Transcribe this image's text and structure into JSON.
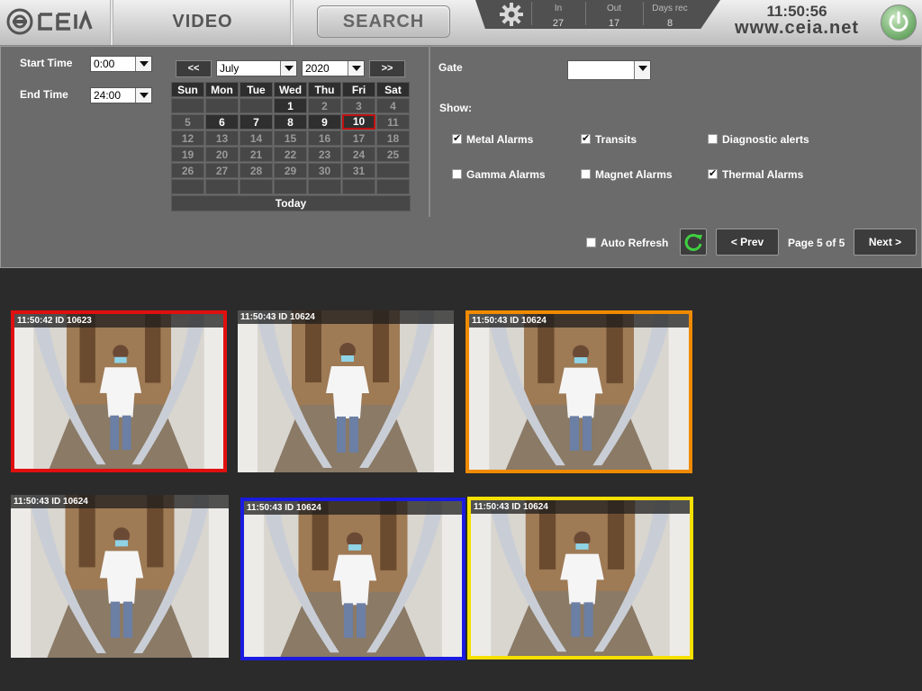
{
  "header": {
    "nav": {
      "video": "VIDEO",
      "search": "SEARCH"
    },
    "stats": [
      {
        "label": "In",
        "value": "27"
      },
      {
        "label": "Out",
        "value": "17"
      },
      {
        "label": "Days rec",
        "value": "8"
      }
    ],
    "clock": "11:50:56",
    "website": "www.ceia.net",
    "icons": {
      "logo": "ceia-logo",
      "settings": "gear-icon",
      "power": "power-icon"
    }
  },
  "filters": {
    "start_time_label": "Start Time",
    "start_time_value": "0:00",
    "end_time_label": "End Time",
    "end_time_value": "24:00",
    "prev_month": "<<",
    "next_month": ">>",
    "month": "July",
    "year": "2020",
    "gate_label": "Gate",
    "gate_value": "",
    "show_label": "Show:"
  },
  "calendar": {
    "weekdays": [
      "Sun",
      "Mon",
      "Tue",
      "Wed",
      "Thu",
      "Fri",
      "Sat"
    ],
    "weeks": [
      [
        "",
        "",
        "",
        "1",
        "2",
        "3",
        "4"
      ],
      [
        "5",
        "6",
        "7",
        "8",
        "9",
        "10",
        "11"
      ],
      [
        "12",
        "13",
        "14",
        "15",
        "16",
        "17",
        "18"
      ],
      [
        "19",
        "20",
        "21",
        "22",
        "23",
        "24",
        "25"
      ],
      [
        "26",
        "27",
        "28",
        "29",
        "30",
        "31",
        ""
      ],
      [
        "",
        "",
        "",
        "",
        "",
        "",
        ""
      ]
    ],
    "active_days": [
      "1",
      "6",
      "7",
      "8",
      "9",
      "10"
    ],
    "selected_day": "10",
    "today_label": "Today"
  },
  "show_options": [
    {
      "label": "Metal Alarms",
      "checked": true
    },
    {
      "label": "Transits",
      "checked": true
    },
    {
      "label": "Diagnostic alerts",
      "checked": false
    },
    {
      "label": "Gamma Alarms",
      "checked": false
    },
    {
      "label": "Magnet Alarms",
      "checked": false
    },
    {
      "label": "Thermal Alarms",
      "checked": true
    }
  ],
  "pager": {
    "auto_refresh_label": "Auto Refresh",
    "auto_refresh_checked": false,
    "prev_label": "< Prev",
    "page_text": "Page 5 of 5",
    "next_label": "Next >"
  },
  "thumbnails": [
    {
      "caption": "11:50:42 ID 10623",
      "border_color": "#e01010"
    },
    {
      "caption": "11:50:43 ID 10624",
      "border_color": ""
    },
    {
      "caption": "11:50:43 ID 10624",
      "border_color": "#f08a00",
      "thermometer_icon": true
    },
    {
      "caption": "11:50:43 ID 10624",
      "border_color": ""
    },
    {
      "caption": "11:50:43 ID 10624",
      "border_color": "#1a1ae0"
    },
    {
      "caption": "11:50:43 ID 10624",
      "border_color": "#f5e000"
    }
  ]
}
